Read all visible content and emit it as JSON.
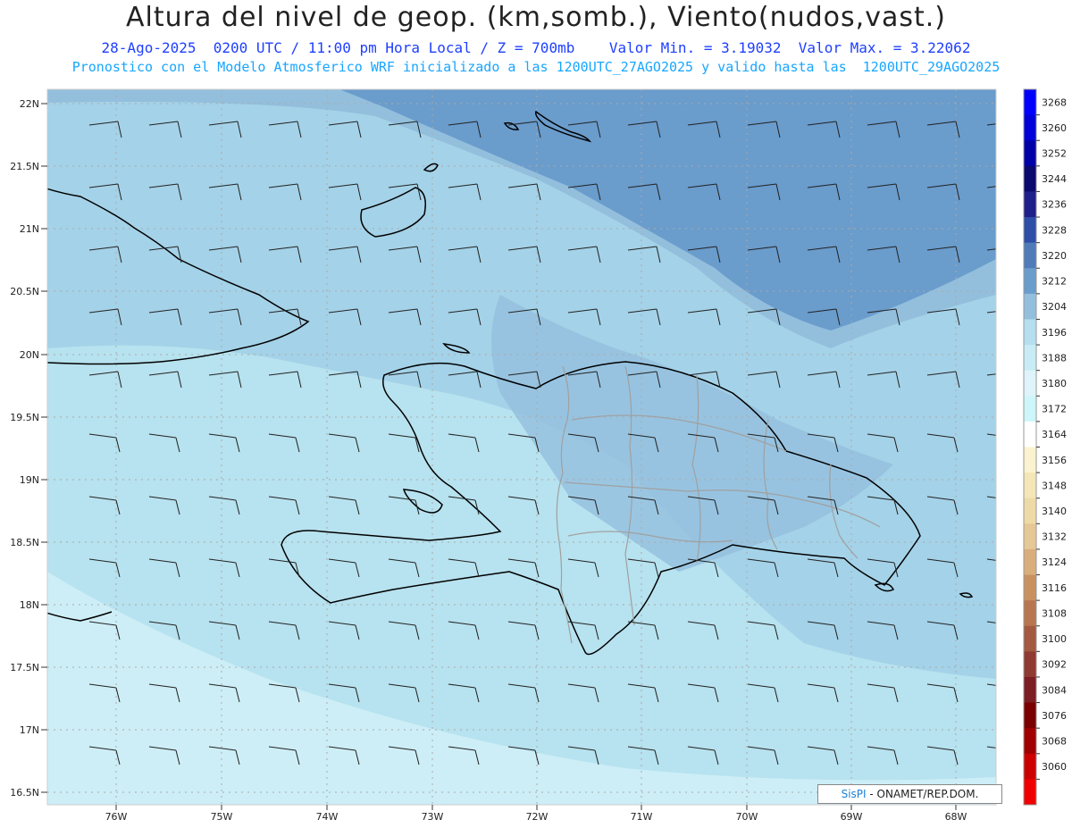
{
  "header": {
    "title": "Altura del nivel de geop. (km,somb.), Viento(nudos,vast.)",
    "subtitle": "28-Ago-2025  0200 UTC / 11:00 pm Hora Local / Z = 700mb    Valor Min. = 3.19032  Valor Max. = 3.22062",
    "model_info": "Pronostico con el Modelo Atmosferico WRF inicializado a las 1200UTC_27AGO2025 y valido hasta las  1200UTC_29AGO2025"
  },
  "axes": {
    "lat_labels": [
      "22N",
      "21.5N",
      "21N",
      "20.5N",
      "20N",
      "19.5N",
      "19N",
      "18.5N",
      "18N",
      "17.5N",
      "17N",
      "16.5N"
    ],
    "lon_labels": [
      "76W",
      "75W",
      "74W",
      "73W",
      "72W",
      "71W",
      "70W",
      "69W",
      "68W"
    ]
  },
  "colorbar": {
    "levels": [
      "3268",
      "3260",
      "3252",
      "3244",
      "3236",
      "3228",
      "3220",
      "3212",
      "3204",
      "3196",
      "3188",
      "3180",
      "3172",
      "3164",
      "3156",
      "3148",
      "3140",
      "3132",
      "3124",
      "3116",
      "3108",
      "3100",
      "3092",
      "3084",
      "3076",
      "3068",
      "3060"
    ],
    "colors": [
      "#0000ff",
      "#0000d8",
      "#0000a8",
      "#0a0a6e",
      "#1f1f8a",
      "#2e4ea8",
      "#4f7bb8",
      "#6a9ccc",
      "#93bfdd",
      "#b5dff0",
      "#c8ecf5",
      "#def4fa",
      "#cdf6fa",
      "#ffffff",
      "#fbf3cf",
      "#f4e6b6",
      "#eedaa6",
      "#e6c796",
      "#d9ad7c",
      "#c99060",
      "#b77650",
      "#a35a40",
      "#8f3b32",
      "#7c1e24",
      "#7a0000",
      "#a00000",
      "#cc0000",
      "#f00000"
    ]
  },
  "map": {
    "region": "Isla La Española y alrededores",
    "wind_barb_color": "#222222",
    "coast_color": "#000000",
    "province_color": "#a0a0a0"
  },
  "footer": {
    "brand": "SisPI",
    "org": " - ONAMET/REP.DOM."
  }
}
